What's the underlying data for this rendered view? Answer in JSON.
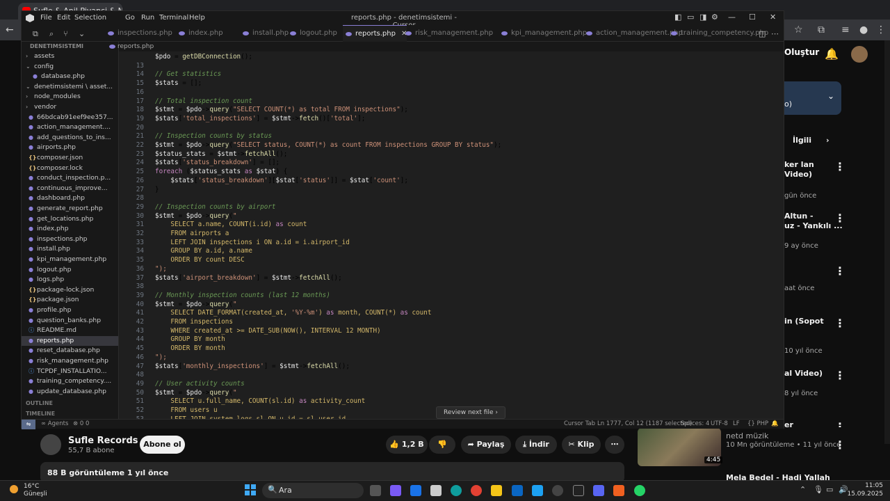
{
  "browser": {
    "tab_title": "Sufle & Anil Piyanci & Nu..."
  },
  "youtube": {
    "create_label": "Oluştur",
    "related_label": "İlgili",
    "sidebar_fragments": [
      {
        "title": "ker lan",
        "sub": "Video)"
      },
      {
        "title": "",
        "sub": "gün önce"
      },
      {
        "title": "Altun -",
        "sub": "uz - Yankılı ..."
      },
      {
        "title": "",
        "sub": "9 ay önce"
      },
      {
        "title": "",
        "sub": "aat önce"
      },
      {
        "title": "in (Sopot",
        "sub": ""
      },
      {
        "title": "",
        "sub": "10 yıl önce"
      },
      {
        "title": "al Video)",
        "sub": ""
      },
      {
        "title": "",
        "sub": "8 yıl önce"
      },
      {
        "title": "er",
        "sub": ""
      }
    ],
    "blue_card_text": "o)",
    "channel_name": "Sufle Records",
    "channel_subs": "55,7 B abone",
    "subscribe_label": "Abone ol",
    "like_count": "1,2 B",
    "share_label": "Paylaş",
    "download_label": "İndir",
    "clip_label": "Klip",
    "views_text": "88 B görüntüleme  1 yıl önce",
    "thumb_duration": "4:45",
    "suggested_channel": "netd müzik",
    "suggested_meta": "10 Mn görüntüleme • 11 yıl önce",
    "suggested_next_title": "Mela Bedel - Hadi Yallah"
  },
  "taskbar": {
    "weather_temp": "16°C",
    "weather_desc": "Güneşli",
    "search_placeholder": "Ara",
    "time": "11:05",
    "date": "15.09.2025"
  },
  "editor": {
    "window_title": "reports.php - denetimsistemi - Cursor",
    "menu": [
      "File",
      "Edit",
      "Selection",
      "Go",
      "Run",
      "Terminal",
      "Help"
    ],
    "tabs": [
      {
        "label": "inspections.php",
        "active": false
      },
      {
        "label": "index.php",
        "active": false
      },
      {
        "label": "install.php",
        "active": false
      },
      {
        "label": "logout.php",
        "active": false
      },
      {
        "label": "reports.php",
        "active": true
      },
      {
        "label": "risk_management.php",
        "active": false
      },
      {
        "label": "kpi_management.php",
        "active": false
      },
      {
        "label": "action_management.php",
        "active": false
      },
      {
        "label": "training_competency.php",
        "active": false
      }
    ],
    "breadcrumb": "reports.php",
    "explorer_header": "DENETIMSISTEMI",
    "tree": [
      {
        "label": "assets",
        "kind": "folder"
      },
      {
        "label": "config",
        "kind": "folder-open"
      },
      {
        "label": "database.php",
        "kind": "php",
        "indent": 1
      },
      {
        "label": "denetimsistemi \\ asset...",
        "kind": "folder-open"
      },
      {
        "label": "node_modules",
        "kind": "folder"
      },
      {
        "label": "vendor",
        "kind": "folder"
      },
      {
        "label": "66bdcab91eef9ee357...",
        "kind": "php"
      },
      {
        "label": "action_management....",
        "kind": "php"
      },
      {
        "label": "add_questions_to_ins...",
        "kind": "php"
      },
      {
        "label": "airports.php",
        "kind": "php"
      },
      {
        "label": "composer.json",
        "kind": "json"
      },
      {
        "label": "composer.lock",
        "kind": "json"
      },
      {
        "label": "conduct_inspection.p...",
        "kind": "php"
      },
      {
        "label": "continuous_improve...",
        "kind": "php"
      },
      {
        "label": "dashboard.php",
        "kind": "php"
      },
      {
        "label": "generate_report.php",
        "kind": "php"
      },
      {
        "label": "get_locations.php",
        "kind": "php"
      },
      {
        "label": "index.php",
        "kind": "php"
      },
      {
        "label": "inspections.php",
        "kind": "php"
      },
      {
        "label": "install.php",
        "kind": "php"
      },
      {
        "label": "kpi_management.php",
        "kind": "php"
      },
      {
        "label": "logout.php",
        "kind": "php"
      },
      {
        "label": "logs.php",
        "kind": "php"
      },
      {
        "label": "package-lock.json",
        "kind": "json"
      },
      {
        "label": "package.json",
        "kind": "json"
      },
      {
        "label": "profile.php",
        "kind": "php"
      },
      {
        "label": "question_banks.php",
        "kind": "php"
      },
      {
        "label": "README.md",
        "kind": "md"
      },
      {
        "label": "reports.php",
        "kind": "php",
        "selected": true
      },
      {
        "label": "reset_database.php",
        "kind": "php"
      },
      {
        "label": "risk_management.php",
        "kind": "php"
      },
      {
        "label": "TCPDF_INSTALLATIO...",
        "kind": "md"
      },
      {
        "label": "training_competency....",
        "kind": "php"
      },
      {
        "label": "update_database.php",
        "kind": "php"
      }
    ],
    "outline_label": "OUTLINE",
    "timeline_label": "TIMELINE",
    "review_button": "Review next file",
    "status": {
      "agents": "Agents",
      "problems": "0  0",
      "cursor_tab": "Cursor Tab",
      "position": "Ln 1777, Col 12 (1187 selected)",
      "spaces": "Spaces: 4",
      "encoding": "UTF-8",
      "eol": "LF",
      "language": "PHP"
    },
    "code": [
      {
        "n": "",
        "t": "$pdo = getDBConnection();"
      },
      {
        "n": "13",
        "t": ""
      },
      {
        "n": "14",
        "t": "// Get statistics"
      },
      {
        "n": "15",
        "t": "$stats = [];"
      },
      {
        "n": "16",
        "t": ""
      },
      {
        "n": "17",
        "t": "// Total inspection count"
      },
      {
        "n": "18",
        "t": "$stmt = $pdo->query(\"SELECT COUNT(*) as total FROM inspections\");"
      },
      {
        "n": "19",
        "t": "$stats['total_inspections'] = $stmt->fetch()['total'];"
      },
      {
        "n": "20",
        "t": ""
      },
      {
        "n": "21",
        "t": "// Inspection counts by status"
      },
      {
        "n": "22",
        "t": "$stmt = $pdo->query(\"SELECT status, COUNT(*) as count FROM inspections GROUP BY status\");"
      },
      {
        "n": "23",
        "t": "$status_stats = $stmt->fetchAll();"
      },
      {
        "n": "24",
        "t": "$stats['status_breakdown'] = [];"
      },
      {
        "n": "25",
        "t": "foreach ($status_stats as $stat) {"
      },
      {
        "n": "26",
        "t": "    $stats['status_breakdown'][$stat['status']] = $stat['count'];"
      },
      {
        "n": "27",
        "t": "}"
      },
      {
        "n": "28",
        "t": ""
      },
      {
        "n": "29",
        "t": "// Inspection counts by airport"
      },
      {
        "n": "30",
        "t": "$stmt = $pdo->query(\""
      },
      {
        "n": "31",
        "t": "    SELECT a.name, COUNT(i.id) as count"
      },
      {
        "n": "32",
        "t": "    FROM airports a"
      },
      {
        "n": "33",
        "t": "    LEFT JOIN inspections i ON a.id = i.airport_id"
      },
      {
        "n": "34",
        "t": "    GROUP BY a.id, a.name"
      },
      {
        "n": "35",
        "t": "    ORDER BY count DESC"
      },
      {
        "n": "36",
        "t": "\");"
      },
      {
        "n": "37",
        "t": "$stats['airport_breakdown'] = $stmt->fetchAll();"
      },
      {
        "n": "38",
        "t": ""
      },
      {
        "n": "39",
        "t": "// Monthly inspection counts (last 12 months)"
      },
      {
        "n": "40",
        "t": "$stmt = $pdo->query(\""
      },
      {
        "n": "41",
        "t": "    SELECT DATE_FORMAT(created_at, '%Y-%m') as month, COUNT(*) as count"
      },
      {
        "n": "42",
        "t": "    FROM inspections"
      },
      {
        "n": "43",
        "t": "    WHERE created_at >= DATE_SUB(NOW(), INTERVAL 12 MONTH)"
      },
      {
        "n": "44",
        "t": "    GROUP BY month"
      },
      {
        "n": "45",
        "t": "    ORDER BY month"
      },
      {
        "n": "46",
        "t": "\");"
      },
      {
        "n": "47",
        "t": "$stats['monthly_inspections'] = $stmt->fetchAll();"
      },
      {
        "n": "48",
        "t": ""
      },
      {
        "n": "49",
        "t": "// User activity counts"
      },
      {
        "n": "50",
        "t": "$stmt = $pdo->query(\""
      },
      {
        "n": "51",
        "t": "    SELECT u.full_name, COUNT(sl.id) as activity_count"
      },
      {
        "n": "52",
        "t": "    FROM users u"
      },
      {
        "n": "53",
        "t": "    LEFT JOIN system_logs sl ON u.id = sl.user_id"
      }
    ]
  }
}
